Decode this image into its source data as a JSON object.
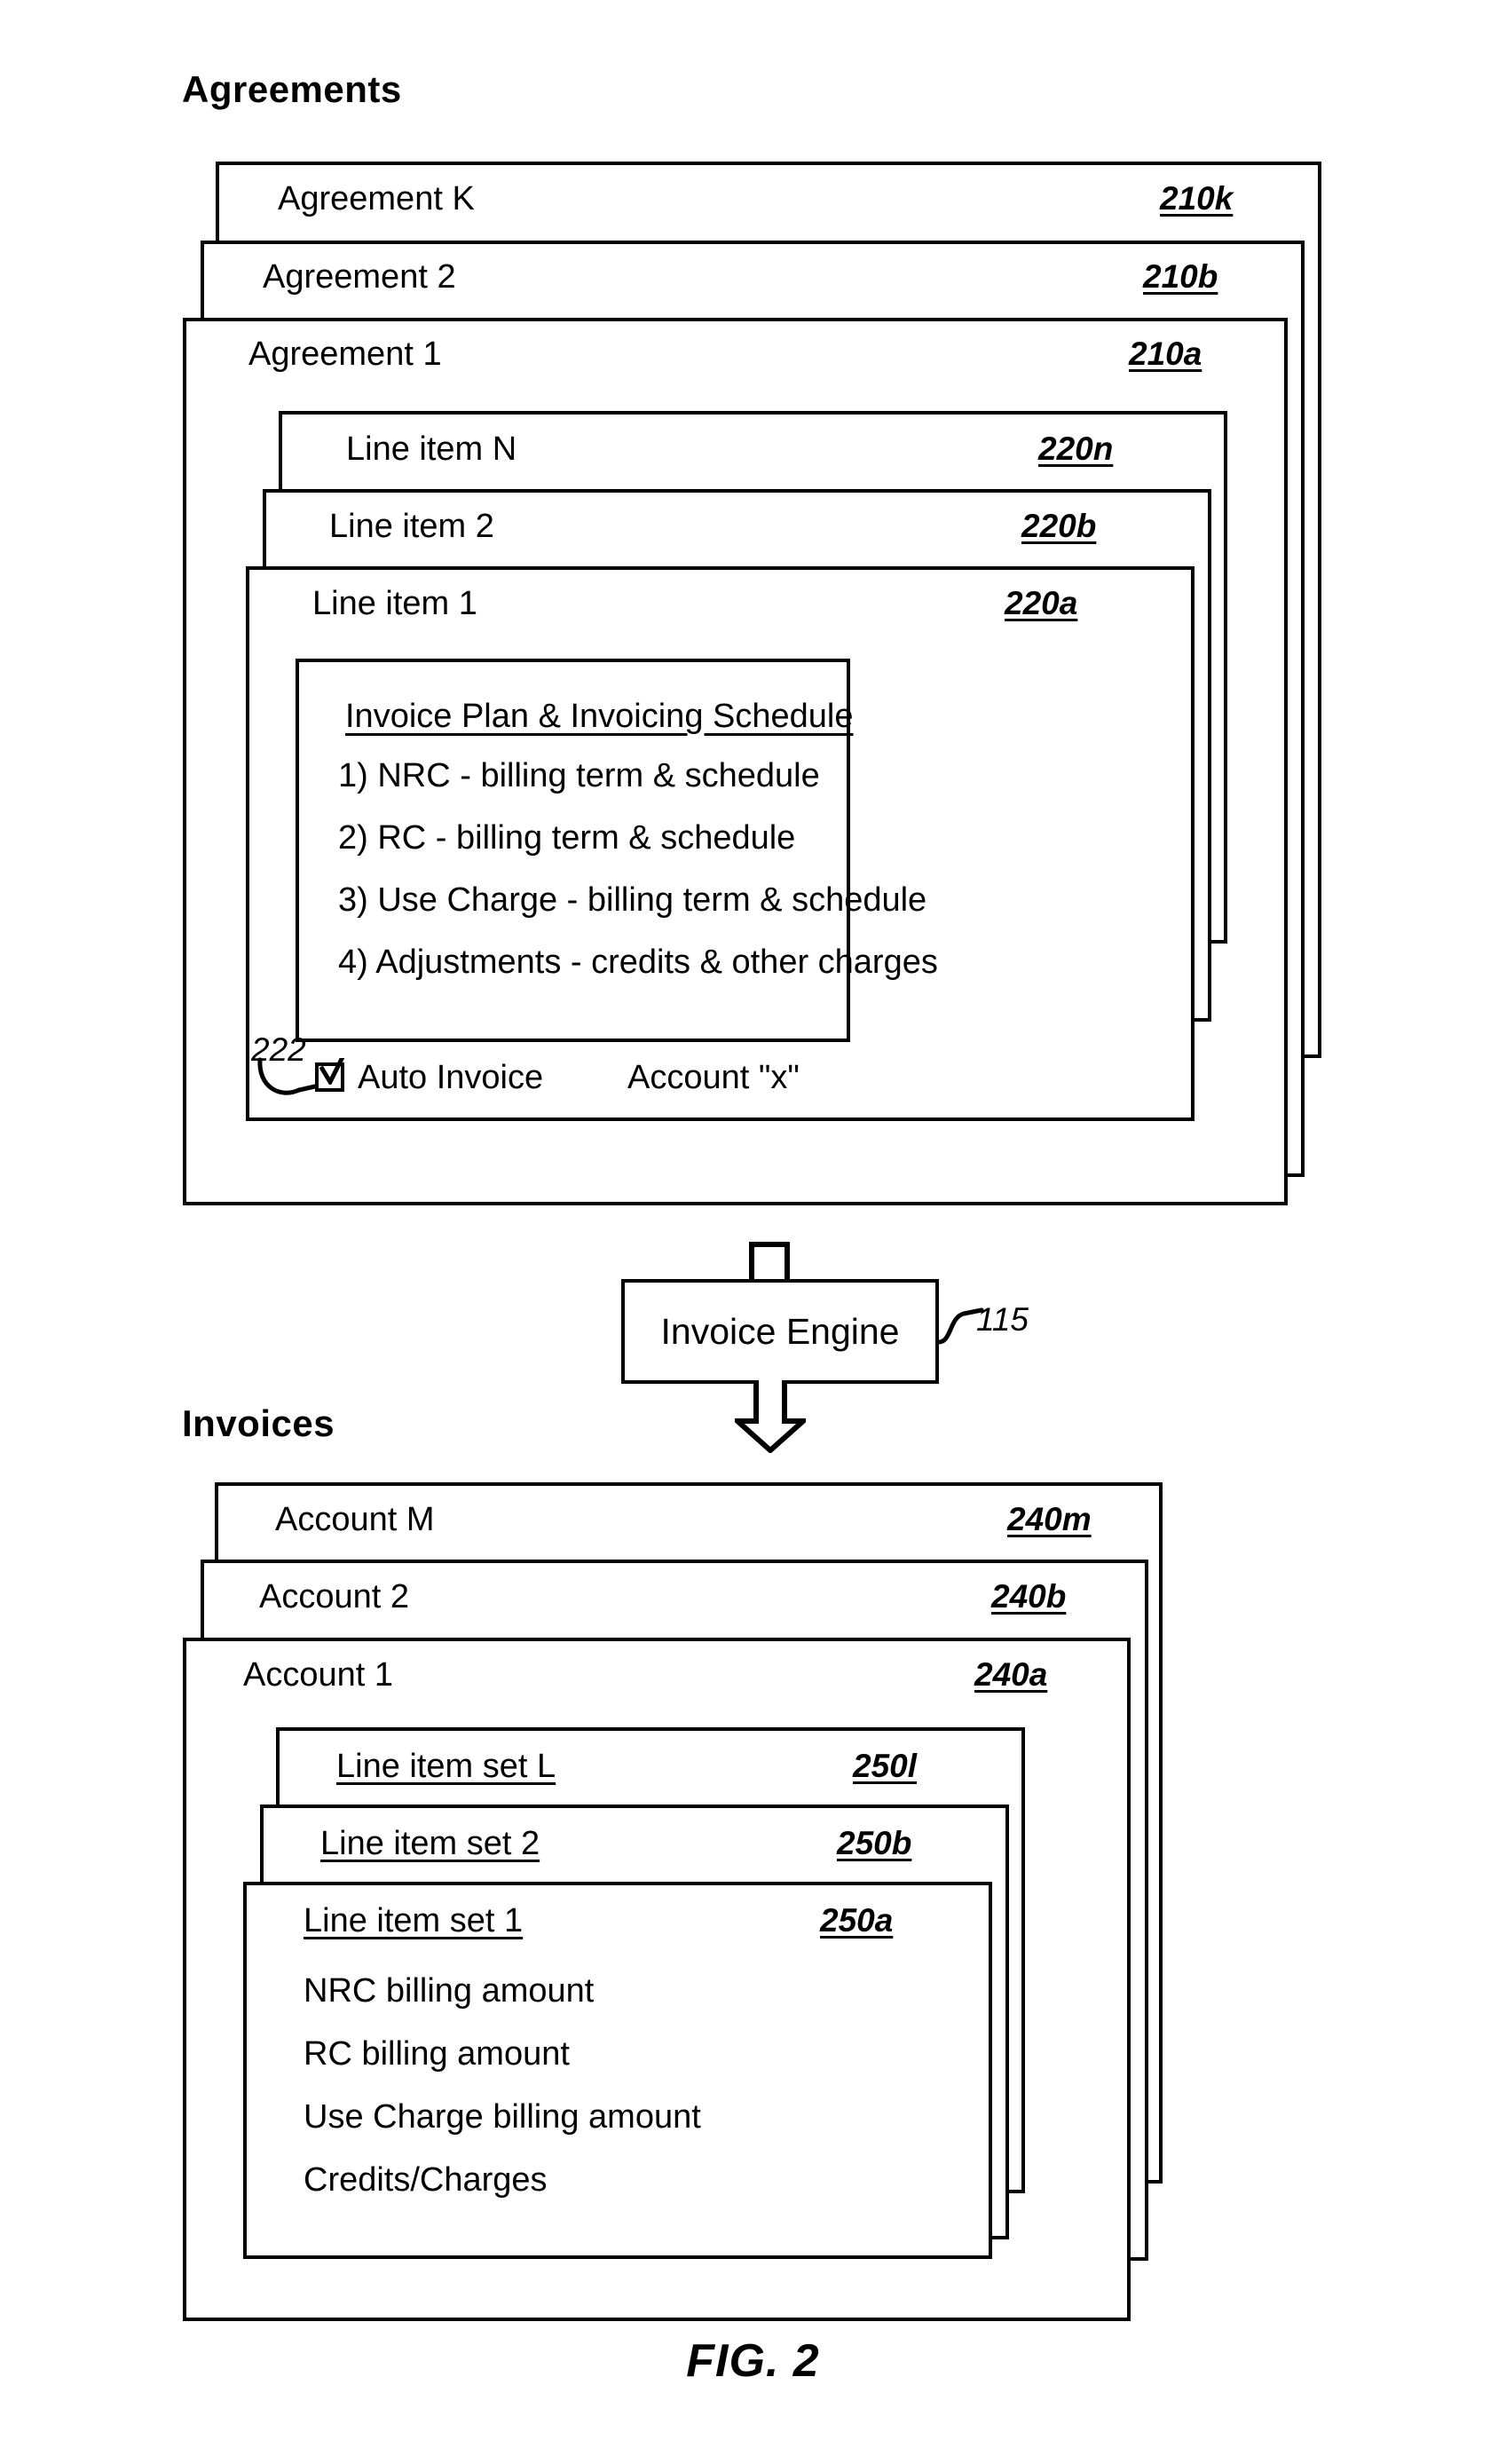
{
  "figure": {
    "caption": "FIG. 2"
  },
  "agreements": {
    "heading": "Agreements",
    "cards": [
      {
        "label": "Agreement K",
        "ref": "210k"
      },
      {
        "label": "Agreement 2",
        "ref": "210b"
      },
      {
        "label": "Agreement 1",
        "ref": "210a"
      }
    ],
    "line_items": [
      {
        "label": "Line item N",
        "ref": "220n"
      },
      {
        "label": "Line item 2",
        "ref": "220b"
      },
      {
        "label": "Line item 1",
        "ref": "220a"
      }
    ],
    "plan": {
      "title": "Invoice Plan & Invoicing Schedule",
      "lines": [
        "1) NRC - billing term & schedule",
        "2) RC - billing term & schedule",
        "3) Use Charge - billing term & schedule",
        "4) Adjustments - credits & other charges"
      ]
    },
    "auto_invoice": {
      "label": "Auto Invoice",
      "checked": "checked",
      "ref": "222",
      "account": "Account \"x\""
    }
  },
  "invoice_engine": {
    "label": "Invoice Engine",
    "ref": "115"
  },
  "invoices": {
    "heading": "Invoices",
    "cards": [
      {
        "label": "Account M",
        "ref": "240m"
      },
      {
        "label": "Account 2",
        "ref": "240b"
      },
      {
        "label": "Account 1",
        "ref": "240a"
      }
    ],
    "line_item_sets": [
      {
        "label": "Line item set L",
        "ref": "250l"
      },
      {
        "label": "Line item set 2",
        "ref": "250b"
      },
      {
        "label": "Line item set 1",
        "ref": "250a"
      }
    ],
    "amounts": [
      "NRC billing amount",
      "RC billing amount",
      "Use Charge billing amount",
      "Credits/Charges"
    ]
  },
  "colors": {
    "ink": "#000000",
    "paper": "#ffffff"
  }
}
